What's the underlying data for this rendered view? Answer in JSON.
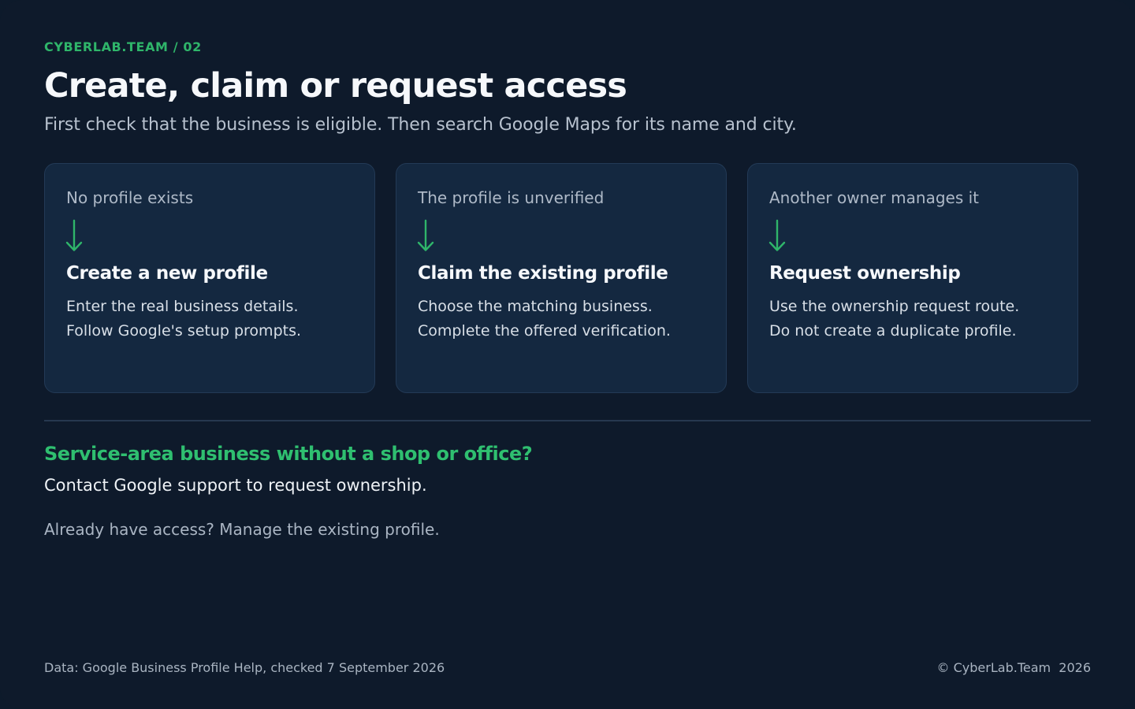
{
  "header": {
    "eyebrow": "CYBERLAB.TEAM / 02",
    "title": "Create, claim or request access",
    "subtitle": "First check that the business is eligible. Then search Google Maps for its name and city."
  },
  "cards": [
    {
      "condition": "No profile exists",
      "arrow_icon": "arrow-down-icon",
      "action": "Create a new profile",
      "detail_line_1": "Enter the real business details.",
      "detail_line_2": "Follow Google's setup prompts."
    },
    {
      "condition": "The profile is unverified",
      "arrow_icon": "arrow-down-icon",
      "action": "Claim the existing profile",
      "detail_line_1": "Choose the matching business.",
      "detail_line_2": "Complete the offered verification."
    },
    {
      "condition": "Another owner manages it",
      "arrow_icon": "arrow-down-icon",
      "action": "Request ownership",
      "detail_line_1": "Use the ownership request route.",
      "detail_line_2": "Do not create a duplicate profile."
    }
  ],
  "note": {
    "heading": "Service-area business without a shop or office?",
    "text": "Contact Google support to request ownership.",
    "secondary": "Already have access? Manage the existing profile."
  },
  "footer": {
    "source": "Data: Google Business Profile Help, checked 7 September 2026",
    "copyright": "© CyberLab.Team  2026"
  },
  "colors": {
    "background": "#0e1a2b",
    "card_background": "#142840",
    "accent_green": "#2fb56a"
  }
}
